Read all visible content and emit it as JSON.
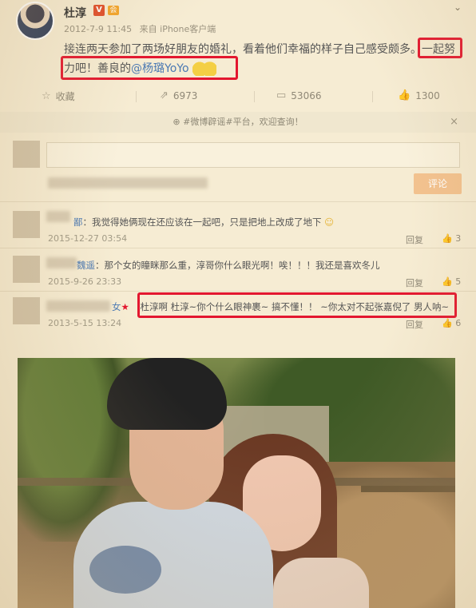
{
  "post": {
    "username": "杜淳",
    "verified_badge": "V",
    "member_badge": "会",
    "time": "2012-7-9 11:45",
    "source": "来自 iPhone客户端",
    "text_part1": "接连两天参加了两场好朋友的婚礼，看着他们幸福的样子自己感受颇多。",
    "text_part2": "一起努力吧！善良的",
    "mention": "@杨璐YoYo",
    "emoji": "hands-emoji"
  },
  "actions": {
    "favorite": {
      "icon": "star-icon",
      "label": "收藏"
    },
    "repost": {
      "icon": "repost-icon",
      "label": "6973"
    },
    "comment": {
      "icon": "comment-icon",
      "label": "53066"
    },
    "like": {
      "icon": "thumbs-up-icon",
      "label": "1300"
    }
  },
  "topic_bar": {
    "icon": "hashtag-icon",
    "text": "#微博辟谣#平台，欢迎查询！",
    "close": "×"
  },
  "comment_box": {
    "submit_label": "评论"
  },
  "comments": [
    {
      "name": "鄙",
      "text": "我觉得她俩现在还应该在一起吧，只是把地上改成了地下",
      "time": "2015-12-27 03:54",
      "reply": "回复",
      "likes": "3"
    },
    {
      "name": "魏遥",
      "text": "那个女的瞳眯那么重，淳哥你什么眼光啊！唉！！！我还是喜欢冬儿",
      "time": "2015-9-26 23:33",
      "reply": "回复",
      "likes": "5"
    },
    {
      "name": "女",
      "text": "杜淳啊 杜淳~你个什么眼神裹~ 搞不懂！！ ~你太对不起张嘉倪了 男人呐~",
      "time": "2013-5-15 13:24",
      "reply": "回复",
      "likes": "6"
    }
  ],
  "colors": {
    "highlight": "#e3172f",
    "link": "#4b79b3",
    "background": "#f6ecd3"
  }
}
